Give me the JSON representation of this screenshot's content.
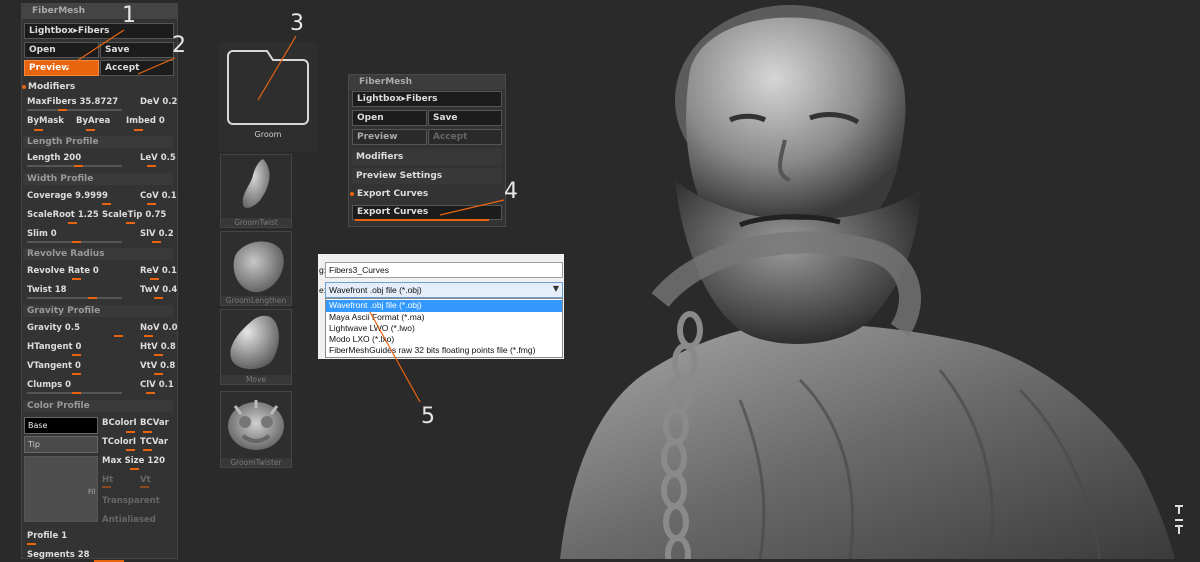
{
  "left_panel": {
    "title": "FiberMesh",
    "lightbox_label": "Lightbox▸Fibers",
    "open_label": "Open",
    "save_label": "Save",
    "preview_label": "Preview",
    "accept_label": "Accept",
    "modifiers_label": "Modifiers",
    "max_fibers": "MaxFibers 35.8727",
    "dev": "DeV 0.2",
    "by_mask": "ByMask",
    "by_area": "ByArea",
    "imbed": "Imbed 0",
    "length_profile": "Length Profile",
    "length": "Length 200",
    "lev": "LeV 0.5",
    "width_profile": "Width Profile",
    "coverage": "Coverage 9.9999",
    "cov": "CoV 0.1",
    "scale_root": "ScaleRoot 1.25",
    "scale_tip": "ScaleTip 0.75",
    "slim": "Slim 0",
    "slv": "SlV 0.2",
    "revolve_radius": "Revolve Radius",
    "revolve_rate": "Revolve Rate 0",
    "rev": "ReV 0.1",
    "twist": "Twist 18",
    "twv": "TwV 0.4",
    "gravity_profile": "Gravity Profile",
    "gravity": "Gravity 0.5",
    "nov": "NoV 0.0",
    "htangent": "HTangent 0",
    "htv": "HtV 0.8",
    "vtangent": "VTangent 0",
    "vtv": "VtV 0.8",
    "clumps": "Clumps 0",
    "clv": "ClV 0.1",
    "color_profile": "Color Profile",
    "base": "Base",
    "tip": "Tip",
    "fill": "Fil",
    "bcolor": "BColorI",
    "bcvar": "BCVar",
    "tcolor": "TColorI",
    "tcvar": "TCVar",
    "max_size": "Max Size 120",
    "ht": "Ht",
    "vt": "Vt",
    "transparent": "Transparent",
    "antialiased": "Antialiased",
    "profile": "Profile 1",
    "segments": "Segments 28"
  },
  "groom": {
    "label": "Groom"
  },
  "brushes": [
    "GroomTwist",
    "GroomLengthen",
    "Move",
    "GroomTwister"
  ],
  "right_panel": {
    "title": "FiberMesh",
    "lightbox_label": "Lightbox▸Fibers",
    "open_label": "Open",
    "save_label": "Save",
    "preview_label": "Preview",
    "accept_label": "Accept",
    "modifiers_label": "Modifiers",
    "preview_settings_label": "Preview Settings",
    "export_curves_header": "Export Curves",
    "export_curves_button": "Export Curves"
  },
  "save_dialog": {
    "filename_label": "g:",
    "filename": "Fibers3_Curves",
    "type_label": "e:",
    "selected_type": "Wavefront .obj file (*.obj)",
    "options": [
      "Wavefront .obj file (*.obj)",
      "Maya Ascii Format (*.ma)",
      "Lightwave LWO (*.lwo)",
      "Modo LXO (*.lxo)",
      "FiberMeshGuides raw 32 bits floating points file (*.fmg)"
    ]
  },
  "callouts": [
    "1",
    "2",
    "3",
    "4",
    "5"
  ],
  "colors": {
    "accent": "#e8640f",
    "background": "#2a2a2a",
    "panel": "#333333"
  }
}
